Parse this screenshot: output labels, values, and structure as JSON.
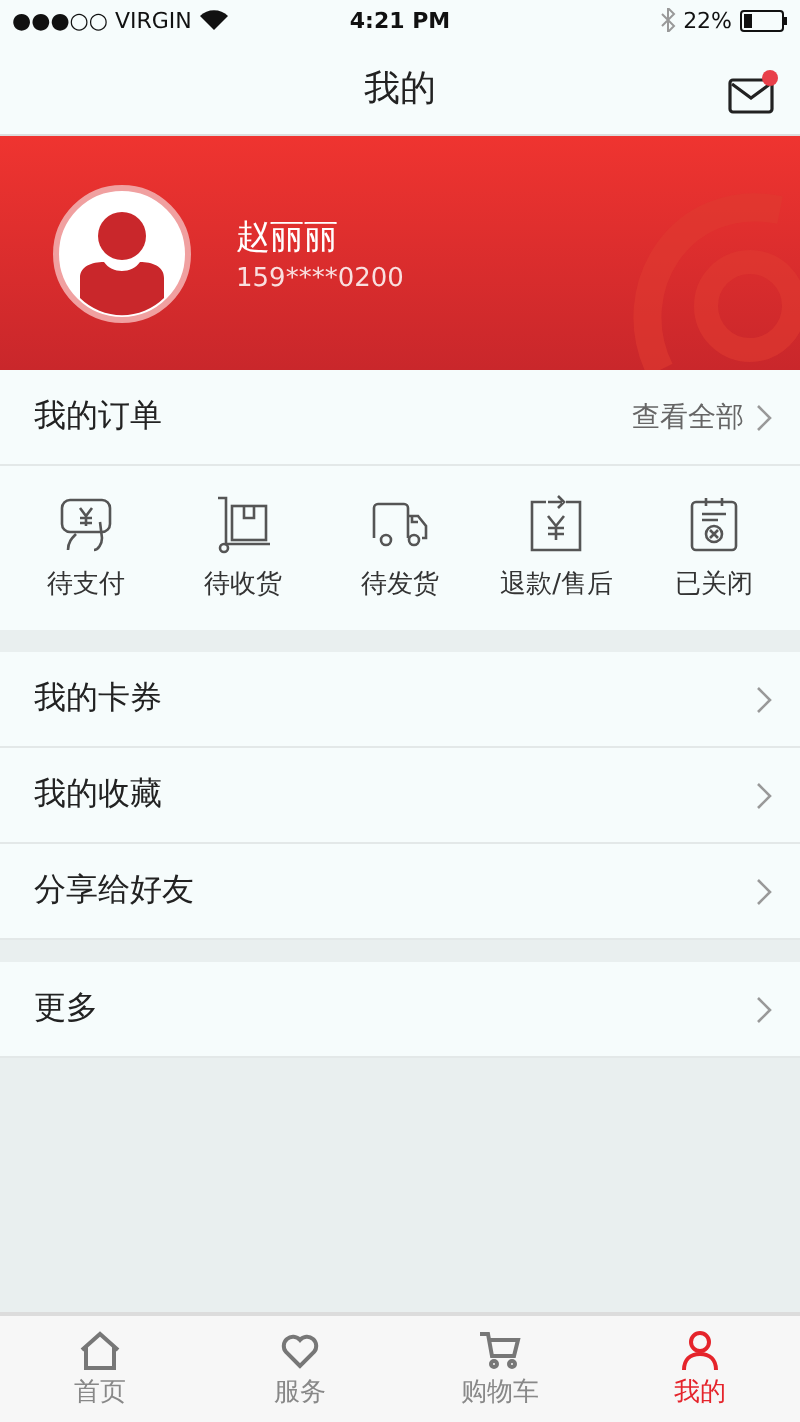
{
  "status_bar": {
    "carrier": "●●●○○ VIRGIN",
    "time": "4:21 PM",
    "battery": "22%"
  },
  "nav": {
    "title": "我的",
    "unread": true
  },
  "profile": {
    "name": "赵丽丽",
    "phone": "159****0200"
  },
  "orders": {
    "title": "我的订单",
    "link": "查看全部",
    "items": [
      {
        "kind": "payment",
        "label": "待支付"
      },
      {
        "kind": "receiving",
        "label": "待收货"
      },
      {
        "kind": "shipping",
        "label": "待发货"
      },
      {
        "kind": "refund",
        "label": "退款/售后"
      },
      {
        "kind": "closed",
        "label": "已关闭"
      }
    ]
  },
  "menu_groups": [
    [
      "我的卡券",
      "我的收藏",
      "分享给好友"
    ],
    [
      "更多"
    ]
  ],
  "tab_bar": [
    {
      "kind": "home",
      "label": "首页",
      "selected": false
    },
    {
      "kind": "service",
      "label": "服务",
      "selected": false
    },
    {
      "kind": "cart",
      "label": "购物车",
      "selected": false
    },
    {
      "kind": "me",
      "label": "我的",
      "selected": true
    }
  ]
}
